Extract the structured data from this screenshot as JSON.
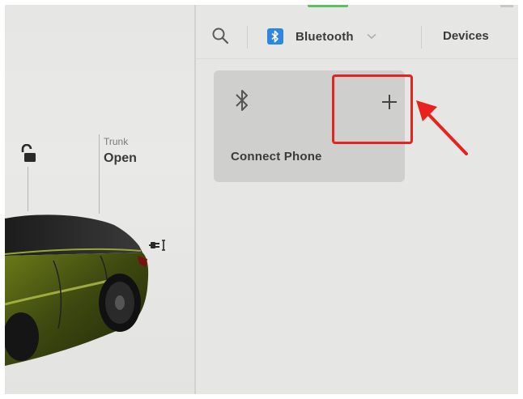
{
  "toolbar": {
    "search_icon": "search-icon",
    "bluetooth_label": "Bluetooth",
    "devices_label": "Devices"
  },
  "trunk": {
    "label": "Trunk",
    "status": "Open"
  },
  "card": {
    "label": "Connect Phone",
    "add_symbol": "+"
  },
  "colors": {
    "bluetooth_badge": "#2f86e0",
    "highlight": "#e8231f",
    "card_bg": "#cfcfcd"
  }
}
